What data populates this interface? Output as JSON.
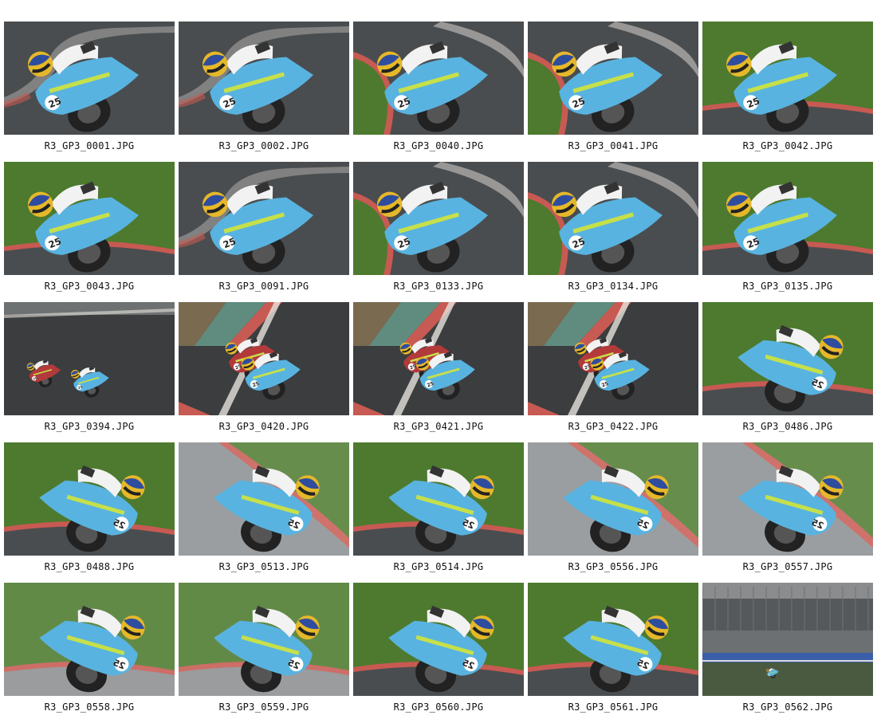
{
  "gallery": {
    "colors": {
      "asphalt": "#4a4d4f",
      "asphalt_dark": "#3b3d3f",
      "grass": "#4d7a2e",
      "grass_dark": "#3e6a24",
      "curb_red": "#c75a52",
      "curb_white": "#e6e2dc",
      "bike_blue": "#59b3e0",
      "bike_dark": "#222222",
      "helmet_yellow": "#e5b82a",
      "helmet_blue": "#2f4d9e",
      "leathers": "#f2f2f2",
      "rider2_red": "#b33a3a"
    },
    "items": [
      {
        "filename": "R3_GP3_0001.JPG",
        "scene": "track-corner",
        "subject": "rider-leaning-left",
        "icon": "photo-thumbnail"
      },
      {
        "filename": "R3_GP3_0002.JPG",
        "scene": "track-corner",
        "subject": "rider-leaning-left",
        "icon": "photo-thumbnail"
      },
      {
        "filename": "R3_GP3_0040.JPG",
        "scene": "track-curb-grass",
        "subject": "rider-leaning-left",
        "icon": "photo-thumbnail"
      },
      {
        "filename": "R3_GP3_0041.JPG",
        "scene": "track-curb-grass",
        "subject": "rider-leaning-left",
        "icon": "photo-thumbnail"
      },
      {
        "filename": "R3_GP3_0042.JPG",
        "scene": "grass-close",
        "subject": "rider-leaning-left",
        "icon": "photo-thumbnail"
      },
      {
        "filename": "R3_GP3_0043.JPG",
        "scene": "grass-close",
        "subject": "rider-leaning-left",
        "icon": "photo-thumbnail"
      },
      {
        "filename": "R3_GP3_0091.JPG",
        "scene": "track-corner",
        "subject": "rider-leaning-left",
        "icon": "photo-thumbnail"
      },
      {
        "filename": "R3_GP3_0133.JPG",
        "scene": "track-curb-grass",
        "subject": "rider-leaning-left",
        "icon": "photo-thumbnail"
      },
      {
        "filename": "R3_GP3_0134.JPG",
        "scene": "track-curb-grass",
        "subject": "rider-leaning-left",
        "icon": "photo-thumbnail"
      },
      {
        "filename": "R3_GP3_0135.JPG",
        "scene": "grass-close",
        "subject": "rider-leaning-left",
        "icon": "photo-thumbnail"
      },
      {
        "filename": "R3_GP3_0394.JPG",
        "scene": "track-wide",
        "subject": "two-riders-far",
        "icon": "photo-thumbnail"
      },
      {
        "filename": "R3_GP3_0420.JPG",
        "scene": "track-straight",
        "subject": "two-riders-near",
        "icon": "photo-thumbnail"
      },
      {
        "filename": "R3_GP3_0421.JPG",
        "scene": "track-straight",
        "subject": "two-riders-near",
        "icon": "photo-thumbnail"
      },
      {
        "filename": "R3_GP3_0422.JPG",
        "scene": "track-straight",
        "subject": "two-riders-near",
        "icon": "photo-thumbnail"
      },
      {
        "filename": "R3_GP3_0486.JPG",
        "scene": "grass-close",
        "subject": "rider-leaning-right",
        "icon": "photo-thumbnail"
      },
      {
        "filename": "R3_GP3_0488.JPG",
        "scene": "grass-close",
        "subject": "rider-leaning-right",
        "icon": "photo-thumbnail"
      },
      {
        "filename": "R3_GP3_0513.JPG",
        "scene": "wet-track-curb",
        "subject": "rider-leaning-right",
        "icon": "photo-thumbnail"
      },
      {
        "filename": "R3_GP3_0514.JPG",
        "scene": "grass-close",
        "subject": "rider-leaning-right",
        "icon": "photo-thumbnail"
      },
      {
        "filename": "R3_GP3_0556.JPG",
        "scene": "wet-track-curb",
        "subject": "rider-leaning-right",
        "icon": "photo-thumbnail"
      },
      {
        "filename": "R3_GP3_0557.JPG",
        "scene": "wet-track-curb",
        "subject": "rider-leaning-right",
        "icon": "photo-thumbnail"
      },
      {
        "filename": "R3_GP3_0558.JPG",
        "scene": "wet-grass",
        "subject": "rider-leaning-right",
        "icon": "photo-thumbnail"
      },
      {
        "filename": "R3_GP3_0559.JPG",
        "scene": "wet-grass",
        "subject": "rider-leaning-right",
        "icon": "photo-thumbnail"
      },
      {
        "filename": "R3_GP3_0560.JPG",
        "scene": "grass-close",
        "subject": "rider-leaning-right",
        "icon": "photo-thumbnail"
      },
      {
        "filename": "R3_GP3_0561.JPG",
        "scene": "grass-close",
        "subject": "rider-leaning-right",
        "icon": "photo-thumbnail"
      },
      {
        "filename": "R3_GP3_0562.JPG",
        "scene": "grandstand-wide",
        "subject": "rider-tiny",
        "icon": "photo-thumbnail"
      }
    ]
  }
}
